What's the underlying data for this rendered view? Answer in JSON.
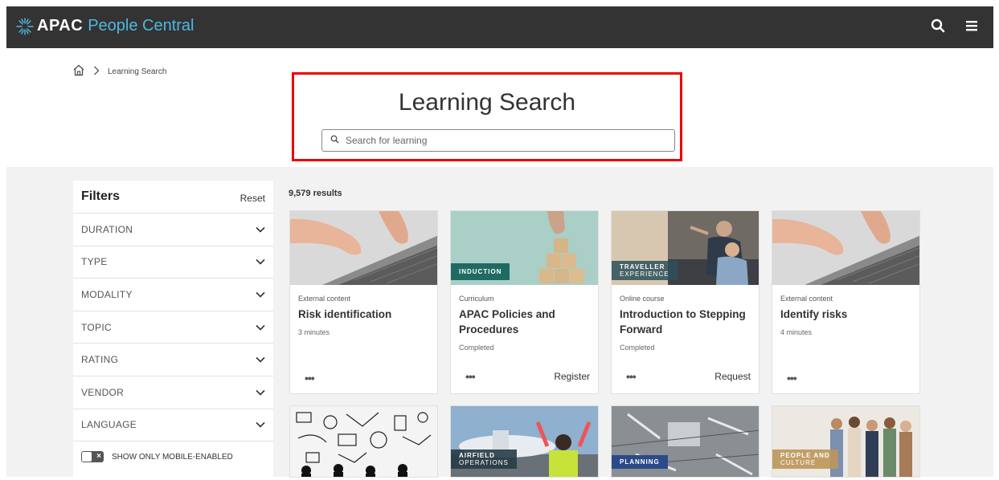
{
  "header": {
    "brand_short": "APAC",
    "brand_name": "People Central",
    "icons": [
      "search-icon",
      "menu-icon"
    ]
  },
  "breadcrumb": {
    "home_icon": "home-icon",
    "separator_icon": "chevron-right-icon",
    "current": "Learning Search"
  },
  "hero": {
    "title": "Learning Search",
    "search_placeholder": "Search for learning",
    "search_value": ""
  },
  "filters": {
    "title": "Filters",
    "reset_label": "Reset",
    "items": [
      {
        "label": "DURATION"
      },
      {
        "label": "TYPE"
      },
      {
        "label": "MODALITY"
      },
      {
        "label": "TOPIC"
      },
      {
        "label": "RATING"
      },
      {
        "label": "VENDOR"
      },
      {
        "label": "LANGUAGE"
      }
    ],
    "mobile_toggle_label": "SHOW ONLY MOBILE-ENABLED",
    "mobile_toggle_on": false
  },
  "results": {
    "count_label": "9,579 results",
    "cards": [
      {
        "type": "External content",
        "title": "Risk identification",
        "sub": "3 minutes",
        "action": "",
        "badge": ""
      },
      {
        "type": "Curriculum",
        "title": "APAC Policies and Procedures",
        "sub": "Completed",
        "action": "Register",
        "badge": "INDUCTION"
      },
      {
        "type": "Online course",
        "title": "Introduction to Stepping Forward",
        "sub": "Completed",
        "action": "Request",
        "badge_line1": "TRAVELLER",
        "badge_line2": "EXPERIENCE"
      },
      {
        "type": "External content",
        "title": "Identify risks",
        "sub": "4 minutes",
        "action": "",
        "badge": ""
      }
    ],
    "row2_badges": {
      "card2_line1": "AIRFIELD",
      "card2_line2": "OPERATIONS",
      "card3": "PLANNING",
      "card4_line1": "PEOPLE AND",
      "card4_line2": "CULTURE"
    }
  },
  "colors": {
    "topbar": "#333333",
    "brand_accent": "#4fb8e0",
    "badge_teal": "#1f6b64",
    "highlight": "#ee0000"
  }
}
